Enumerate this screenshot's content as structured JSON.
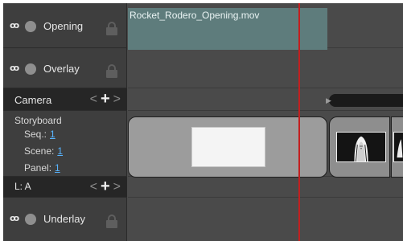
{
  "tracks": {
    "opening": {
      "label": "Opening",
      "eye_glyph": "ꝏ"
    },
    "overlay": {
      "label": "Overlay",
      "eye_glyph": "ꝏ"
    },
    "camera": {
      "label": "Camera",
      "nav_left": "<",
      "nav_plus": "+",
      "nav_right": ">"
    },
    "storyboard": {
      "label": "Storyboard",
      "seq_label": "Seq.:",
      "seq_value": "1",
      "scene_label": "Scene:",
      "scene_value": "1",
      "panel_label": "Panel:",
      "panel_value": "1"
    },
    "la": {
      "label": "L: A",
      "nav_left": "<",
      "nav_plus": "+",
      "nav_right": ">"
    },
    "underlay": {
      "label": "Underlay",
      "eye_glyph": "ꝏ"
    }
  },
  "timeline": {
    "audio_clip_name": "Rocket_Rodero_Opening.mov",
    "camera_marker": "▶"
  },
  "colors": {
    "playhead": "#c31f1f",
    "audio_clip": "#5e7c7c",
    "link": "#58b4ff"
  }
}
